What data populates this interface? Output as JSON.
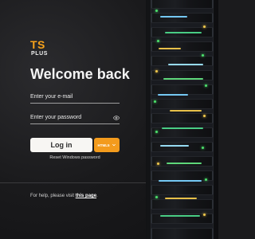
{
  "logo": {
    "brand": "TS",
    "sub": "PLUS"
  },
  "title": "Welcome back",
  "email": {
    "placeholder": "Enter your e-mail"
  },
  "password": {
    "placeholder": "Enter your password"
  },
  "login": {
    "label": "Log in"
  },
  "mode": {
    "label": "HTML5"
  },
  "reset": {
    "label": "Reset Windows password"
  },
  "help": {
    "prefix": "For help, please visit ",
    "link": "this page",
    "suffix": "."
  },
  "colors": {
    "accent": "#f39b1d",
    "brand_orange": "#f7a21b",
    "panel": "#1a1a1c"
  },
  "icons": {
    "password_visibility": "eye-icon",
    "mode_dropdown": "chevron-down-icon"
  }
}
